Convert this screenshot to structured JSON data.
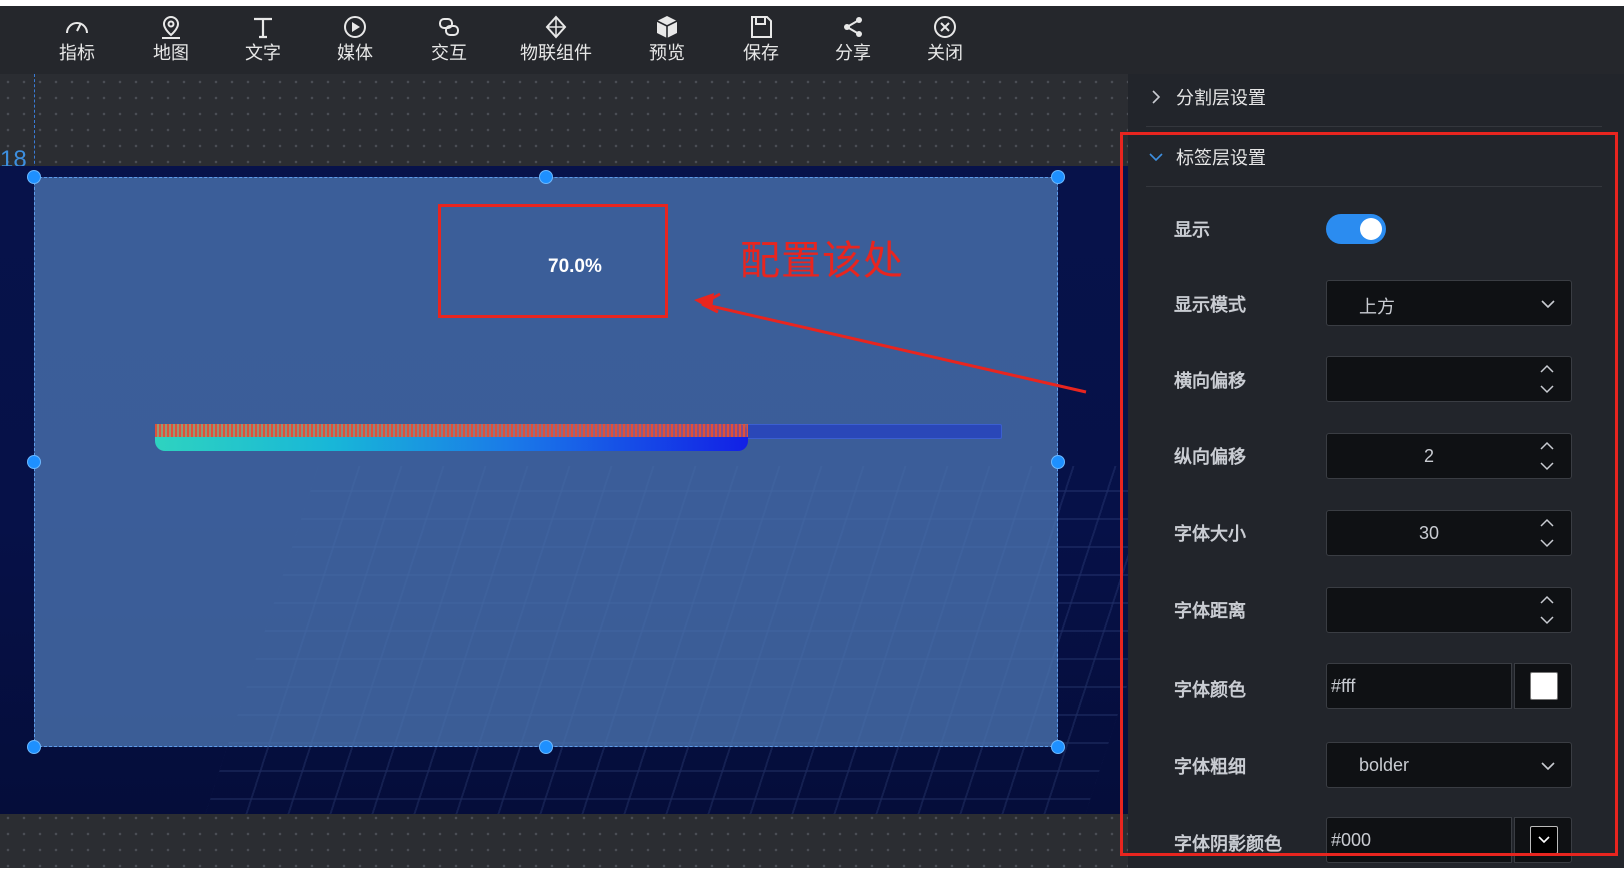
{
  "toolbar": {
    "items": [
      {
        "label": "指标",
        "icon": "gauge-icon"
      },
      {
        "label": "地图",
        "icon": "map-pin-icon"
      },
      {
        "label": "文字",
        "icon": "text-icon"
      },
      {
        "label": "媒体",
        "icon": "play-circle-icon"
      },
      {
        "label": "交互",
        "icon": "chain-link-icon"
      },
      {
        "label": "物联组件",
        "icon": "iot-component-icon"
      },
      {
        "label": "预览",
        "icon": "cube-icon"
      },
      {
        "label": "保存",
        "icon": "floppy-disk-icon"
      },
      {
        "label": "分享",
        "icon": "share-icon"
      },
      {
        "label": "关闭",
        "icon": "close-circle-icon"
      }
    ]
  },
  "canvas": {
    "ruler_number": "18",
    "progress_label": "70.0%",
    "progress_percent": 70.0,
    "annotation_text": "配置该处"
  },
  "panel": {
    "section_collapsed": "分割层设置",
    "section_expanded": "标签层设置",
    "rows": {
      "show_label": "显示",
      "show_value": true,
      "mode_label": "显示模式",
      "mode_value": "上方",
      "h_offset_label": "横向偏移",
      "h_offset_value": "",
      "v_offset_label": "纵向偏移",
      "v_offset_value": "2",
      "font_size_label": "字体大小",
      "font_size_value": "30",
      "font_distance_label": "字体距离",
      "font_distance_value": "",
      "font_color_label": "字体颜色",
      "font_color_value": "#fff",
      "font_weight_label": "字体粗细",
      "font_weight_value": "bolder",
      "shadow_color_label": "字体阴影颜色",
      "shadow_color_value": "#000"
    }
  },
  "colors": {
    "accent": "#2b8cf0",
    "annotation": "#e8251f",
    "panel_bg": "#22252b",
    "toolbar_bg": "#25272c"
  }
}
